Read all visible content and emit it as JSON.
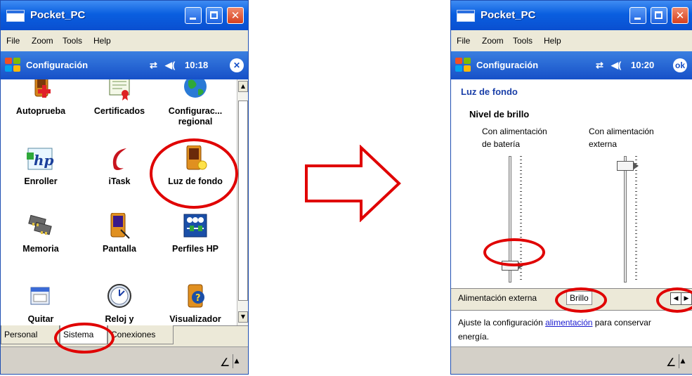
{
  "window1": {
    "title": "Pocket_PC",
    "menu": [
      "File",
      "Zoom",
      "Tools",
      "Help"
    ],
    "ppc_title": "Configuración",
    "status_time": "10:18",
    "close_label": "✕",
    "apps": [
      {
        "label": "Autoprueba",
        "label2": "",
        "icon": "self-test-icon"
      },
      {
        "label": "Certificados",
        "label2": "",
        "icon": "certificate-icon"
      },
      {
        "label": "Configurac...",
        "label2": "regional",
        "icon": "globe-icon"
      },
      {
        "label": "Enroller",
        "label2": "",
        "icon": "hp-enroller-icon"
      },
      {
        "label": "iTask",
        "label2": "",
        "icon": "itask-icon"
      },
      {
        "label": "Luz de fondo",
        "label2": "",
        "icon": "backlight-icon"
      },
      {
        "label": "Memoria",
        "label2": "",
        "icon": "memory-icon"
      },
      {
        "label": "Pantalla",
        "label2": "",
        "icon": "screen-icon"
      },
      {
        "label": "Perfiles HP",
        "label2": "",
        "icon": "hp-profiles-icon"
      },
      {
        "label": "Quitar",
        "label2": "",
        "icon": "remove-programs-icon"
      },
      {
        "label": "Reloj y",
        "label2": "",
        "icon": "clock-icon"
      },
      {
        "label": "Visualizador",
        "label2": "",
        "icon": "viewer-icon"
      }
    ],
    "tabs": [
      "Personal",
      "Sistema",
      "Conexiones"
    ],
    "active_tab": "Sistema"
  },
  "window2": {
    "title": "Pocket_PC",
    "menu": [
      "File",
      "Zoom",
      "Tools",
      "Help"
    ],
    "ppc_title": "Configuración",
    "status_time": "10:20",
    "ok_label": "ok",
    "section_title": "Luz de fondo",
    "group_label": "Nivel de brillo",
    "slider_battery": {
      "label_line1": "Con alimentación",
      "label_line2": "de batería",
      "level": 0.1
    },
    "slider_external": {
      "label_line1": "Con alimentación",
      "label_line2": "externa",
      "level": 0.96
    },
    "tabs": [
      "Alimentación externa",
      "Brillo"
    ],
    "active_tab": "Brillo",
    "info_text_before": "Ajuste la configuración ",
    "info_link": "alimentación",
    "info_text_after": " para conservar energía."
  },
  "colors": {
    "title_blue": "#0a5fe0",
    "highlight_red": "#e00000",
    "link": "#1a1acf"
  }
}
